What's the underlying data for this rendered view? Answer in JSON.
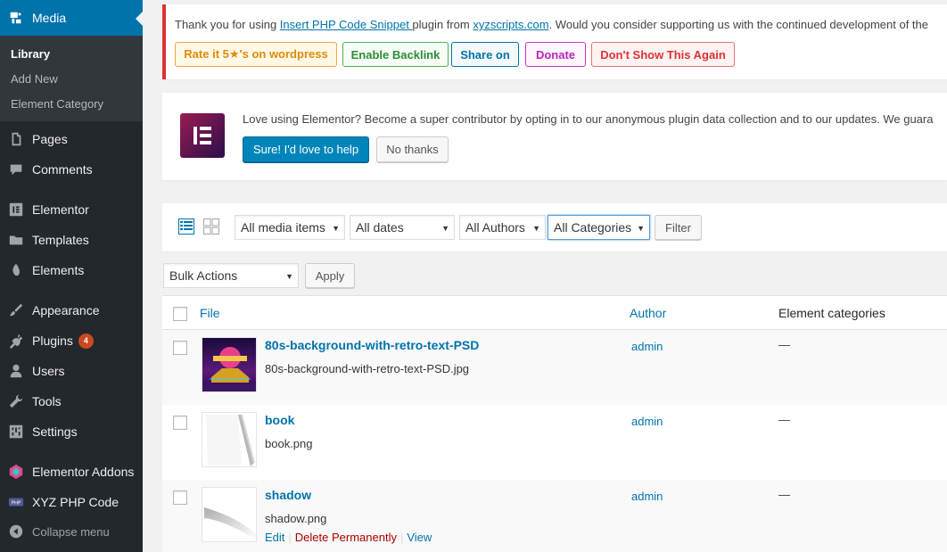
{
  "sidebar": {
    "media_label": "Media",
    "submenu": [
      "Library",
      "Add New",
      "Element Category"
    ],
    "items": [
      {
        "label": "Pages",
        "icon": "pages-icon"
      },
      {
        "label": "Comments",
        "icon": "comments-icon"
      },
      {
        "label": "Elementor",
        "icon": "elementor-icon"
      },
      {
        "label": "Templates",
        "icon": "folder-icon"
      },
      {
        "label": "Elements",
        "icon": "elements-icon"
      },
      {
        "label": "Appearance",
        "icon": "paintbrush-icon"
      },
      {
        "label": "Plugins",
        "icon": "plugin-icon",
        "badge": "4"
      },
      {
        "label": "Users",
        "icon": "user-icon"
      },
      {
        "label": "Tools",
        "icon": "wrench-icon"
      },
      {
        "label": "Settings",
        "icon": "settings-icon"
      },
      {
        "label": "Elementor Addons",
        "icon": "addons-icon"
      },
      {
        "label": "XYZ PHP Code",
        "icon": "php-icon"
      }
    ],
    "collapse_label": "Collapse menu"
  },
  "notice_php": {
    "text_before": "Thank you for using ",
    "plugin_link": "Insert PHP Code Snippet ",
    "text_mid": "plugin from ",
    "site_link": "xyzscripts.com",
    "text_after": ". Would you consider supporting us with the continued development of the",
    "buttons": {
      "rate": "Rate it 5★'s on wordpress",
      "backlink": "Enable Backlink",
      "share": "Share on",
      "donate": "Donate",
      "dont_show": "Don't Show This Again"
    }
  },
  "notice_elementor": {
    "text": "Love using Elementor? Become a super contributor by opting in to our anonymous plugin data collection and to our updates. We guara",
    "accept": "Sure! I'd love to help",
    "decline": "No thanks"
  },
  "toolbar": {
    "media_filter": "All media items",
    "date_filter": "All dates",
    "author_filter": "All Authors",
    "category_filter": "All Categories",
    "filter_button": "Filter",
    "bulk_actions": "Bulk Actions",
    "apply_button": "Apply"
  },
  "table": {
    "columns": {
      "file": "File",
      "author": "Author",
      "categories": "Element categories"
    },
    "rows": [
      {
        "title": "80s-background-with-retro-text-PSD",
        "filename": "80s-background-with-retro-text-PSD.jpg",
        "author": "admin",
        "categories": "—"
      },
      {
        "title": "book",
        "filename": "book.png",
        "author": "admin",
        "categories": "—"
      },
      {
        "title": "shadow",
        "filename": "shadow.png",
        "author": "admin",
        "categories": "—",
        "actions": [
          "Edit",
          "Delete Permanently",
          "View"
        ]
      }
    ]
  },
  "colors": {
    "admin_blue": "#0073aa",
    "sidebar_bg": "#23282d",
    "error_red": "#dc3232"
  }
}
